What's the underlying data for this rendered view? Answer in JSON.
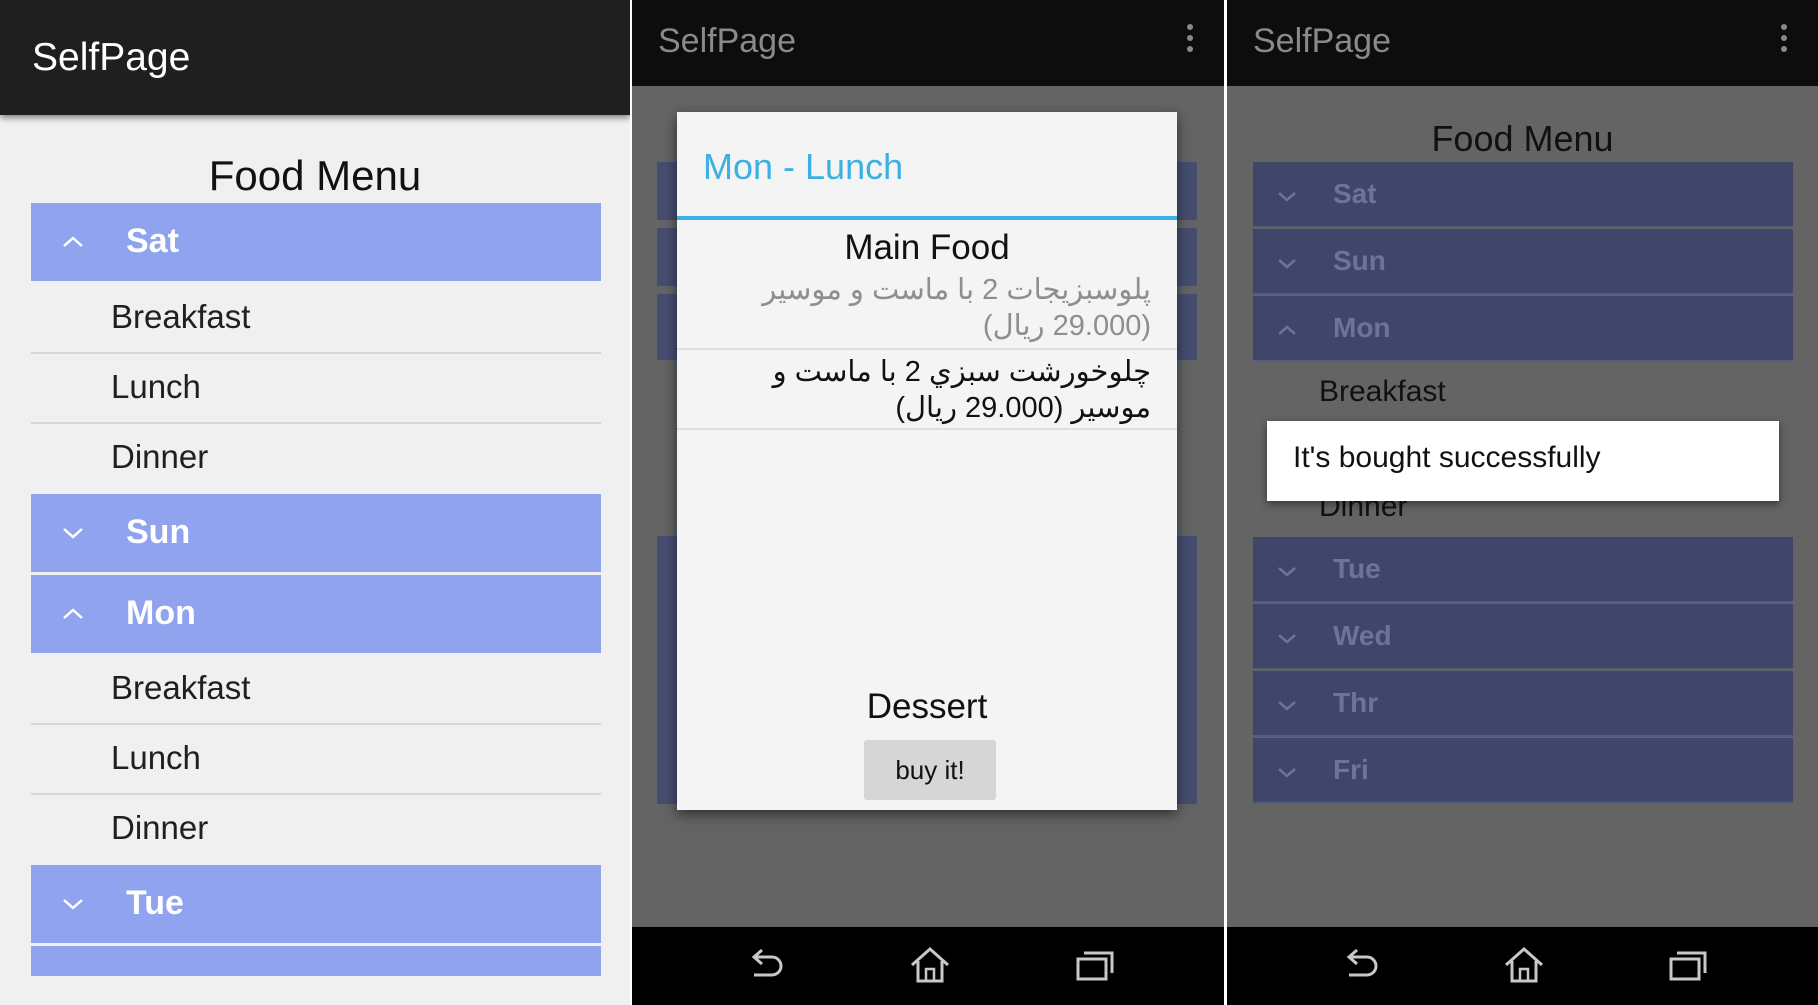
{
  "app_title": "SelfPage",
  "panel1": {
    "heading": "Food Menu",
    "days": [
      {
        "label": "Sat",
        "expanded": true,
        "meals": [
          "Breakfast",
          "Lunch",
          "Dinner"
        ]
      },
      {
        "label": "Sun",
        "expanded": false
      },
      {
        "label": "Mon",
        "expanded": true,
        "meals": [
          "Breakfast",
          "Lunch",
          "Dinner"
        ]
      },
      {
        "label": "Tue",
        "expanded": false
      }
    ]
  },
  "panel2": {
    "dialog": {
      "title": "Mon - Lunch",
      "main_food_heading": "Main Food",
      "items": [
        {
          "text": "پلوسبزیجات 2 با ماست و موسیر (29.000 ریال)",
          "dimmed": true
        },
        {
          "text": "چلوخورشت سبزي 2 با ماست و موسیر (29.000 ریال)",
          "dimmed": false
        }
      ],
      "dessert_heading": "Dessert",
      "buy_button": "buy it!"
    }
  },
  "panel3": {
    "heading": "Food Menu",
    "days_top": [
      {
        "label": "Sat",
        "expanded": false
      },
      {
        "label": "Sun",
        "expanded": false
      },
      {
        "label": "Mon",
        "expanded": true
      }
    ],
    "meals": [
      "Breakfast",
      "Dinner"
    ],
    "days_bottom": [
      {
        "label": "Tue",
        "expanded": false
      },
      {
        "label": "Wed",
        "expanded": false
      },
      {
        "label": "Thr",
        "expanded": false
      },
      {
        "label": "Fri",
        "expanded": false
      }
    ],
    "toast": "It's bought successfully"
  },
  "colors": {
    "accent": "#3ab1e0",
    "group_header": "#8fa3ef",
    "action_bar": "#1f1f1f"
  },
  "icons": [
    "chevron-up-icon",
    "chevron-down-icon",
    "overflow-menu-icon",
    "back-icon",
    "home-icon",
    "recents-icon"
  ]
}
